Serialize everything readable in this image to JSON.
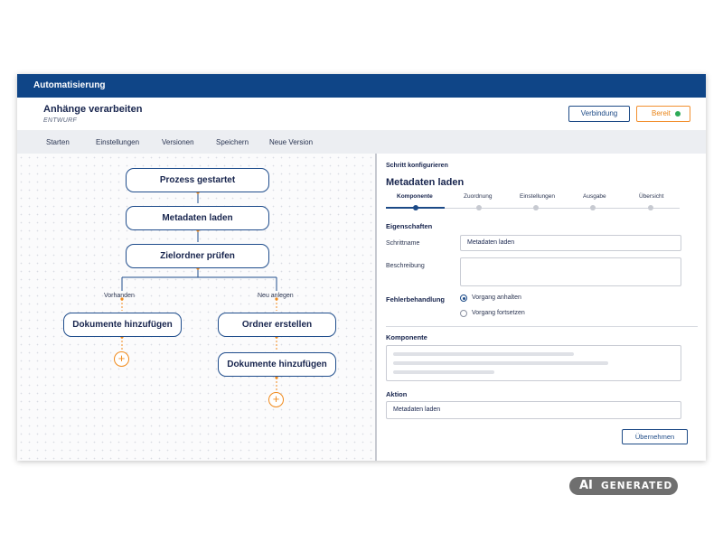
{
  "app": {
    "title": "Automatisierung"
  },
  "header": {
    "flow_name": "Anhänge verarbeiten",
    "flow_state": "ENTWURF",
    "connect_label": "Verbindung",
    "status_label": "Bereit",
    "status_color": "#2eaa57"
  },
  "toolbar": {
    "items": [
      "Starten",
      "Einstellungen",
      "Versionen",
      "Speichern",
      "Neue Version"
    ]
  },
  "flow": {
    "nodes": {
      "start": "Prozess gestartet",
      "metadata": "Metadaten laden",
      "check": "Zielordner prüfen",
      "add_docs_left": "Dokumente hinzufügen",
      "create_folder": "Ordner erstellen",
      "add_docs_right": "Dokumente hinzufügen"
    },
    "branches": {
      "left": "Vorhanden",
      "right": "Neu anlegen"
    },
    "add_symbol": "+"
  },
  "panel": {
    "subtitle": "Schritt konfigurieren",
    "title": "Metadaten laden",
    "steps": [
      "Komponente",
      "Zuordnung",
      "Einstellungen",
      "Ausgabe",
      "Übersicht"
    ],
    "active_step": "Komponente",
    "properties_heading": "Eigenschaften",
    "step_name_label": "Schrittname",
    "step_name_value": "Metadaten laden",
    "description_label": "Beschreibung",
    "description_value": "",
    "error_handling_label": "Fehlerbehandlung",
    "error_options": [
      "Vorgang anhalten",
      "Vorgang fortsetzen"
    ],
    "error_selected": "Vorgang anhalten",
    "component_heading": "Komponente",
    "action_heading": "Aktion",
    "action_value": "Metadaten laden",
    "apply_label": "Übernehmen"
  },
  "colors": {
    "brand": "#0f4587",
    "accent": "#f08a1c",
    "node_border": "#1f4d8c"
  },
  "badge": {
    "ai": "AI",
    "text": "GENERATED"
  }
}
